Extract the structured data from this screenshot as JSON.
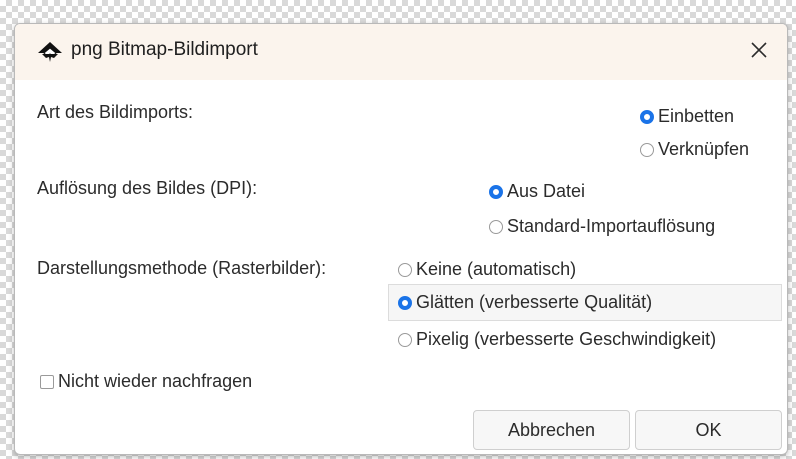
{
  "dialog": {
    "title": "png Bitmap-Bildimport",
    "close_glyph": "✕",
    "icon": "inkscape-icon"
  },
  "import_type": {
    "label": "Art des Bildimports:",
    "options": [
      {
        "label": "Einbetten",
        "selected": true
      },
      {
        "label": "Verknüpfen",
        "selected": false
      }
    ]
  },
  "dpi": {
    "label": "Auflösung des Bildes (DPI):",
    "options": [
      {
        "label": "Aus Datei",
        "selected": true
      },
      {
        "label": "Standard-Importauflösung",
        "selected": false
      }
    ]
  },
  "render": {
    "label": "Darstellungsmethode (Rasterbilder):",
    "options": [
      {
        "label": "Keine (automatisch)",
        "selected": false
      },
      {
        "label": "Glätten (verbesserte Qualität)",
        "selected": true
      },
      {
        "label": "Pixelig (verbesserte Geschwindigkeit)",
        "selected": false
      }
    ]
  },
  "dont_ask": {
    "label": "Nicht wieder nachfragen",
    "checked": false
  },
  "buttons": {
    "cancel": "Abbrechen",
    "ok": "OK"
  },
  "colors": {
    "accent": "#1a73e8",
    "titlebar": "#fbf4ed"
  }
}
